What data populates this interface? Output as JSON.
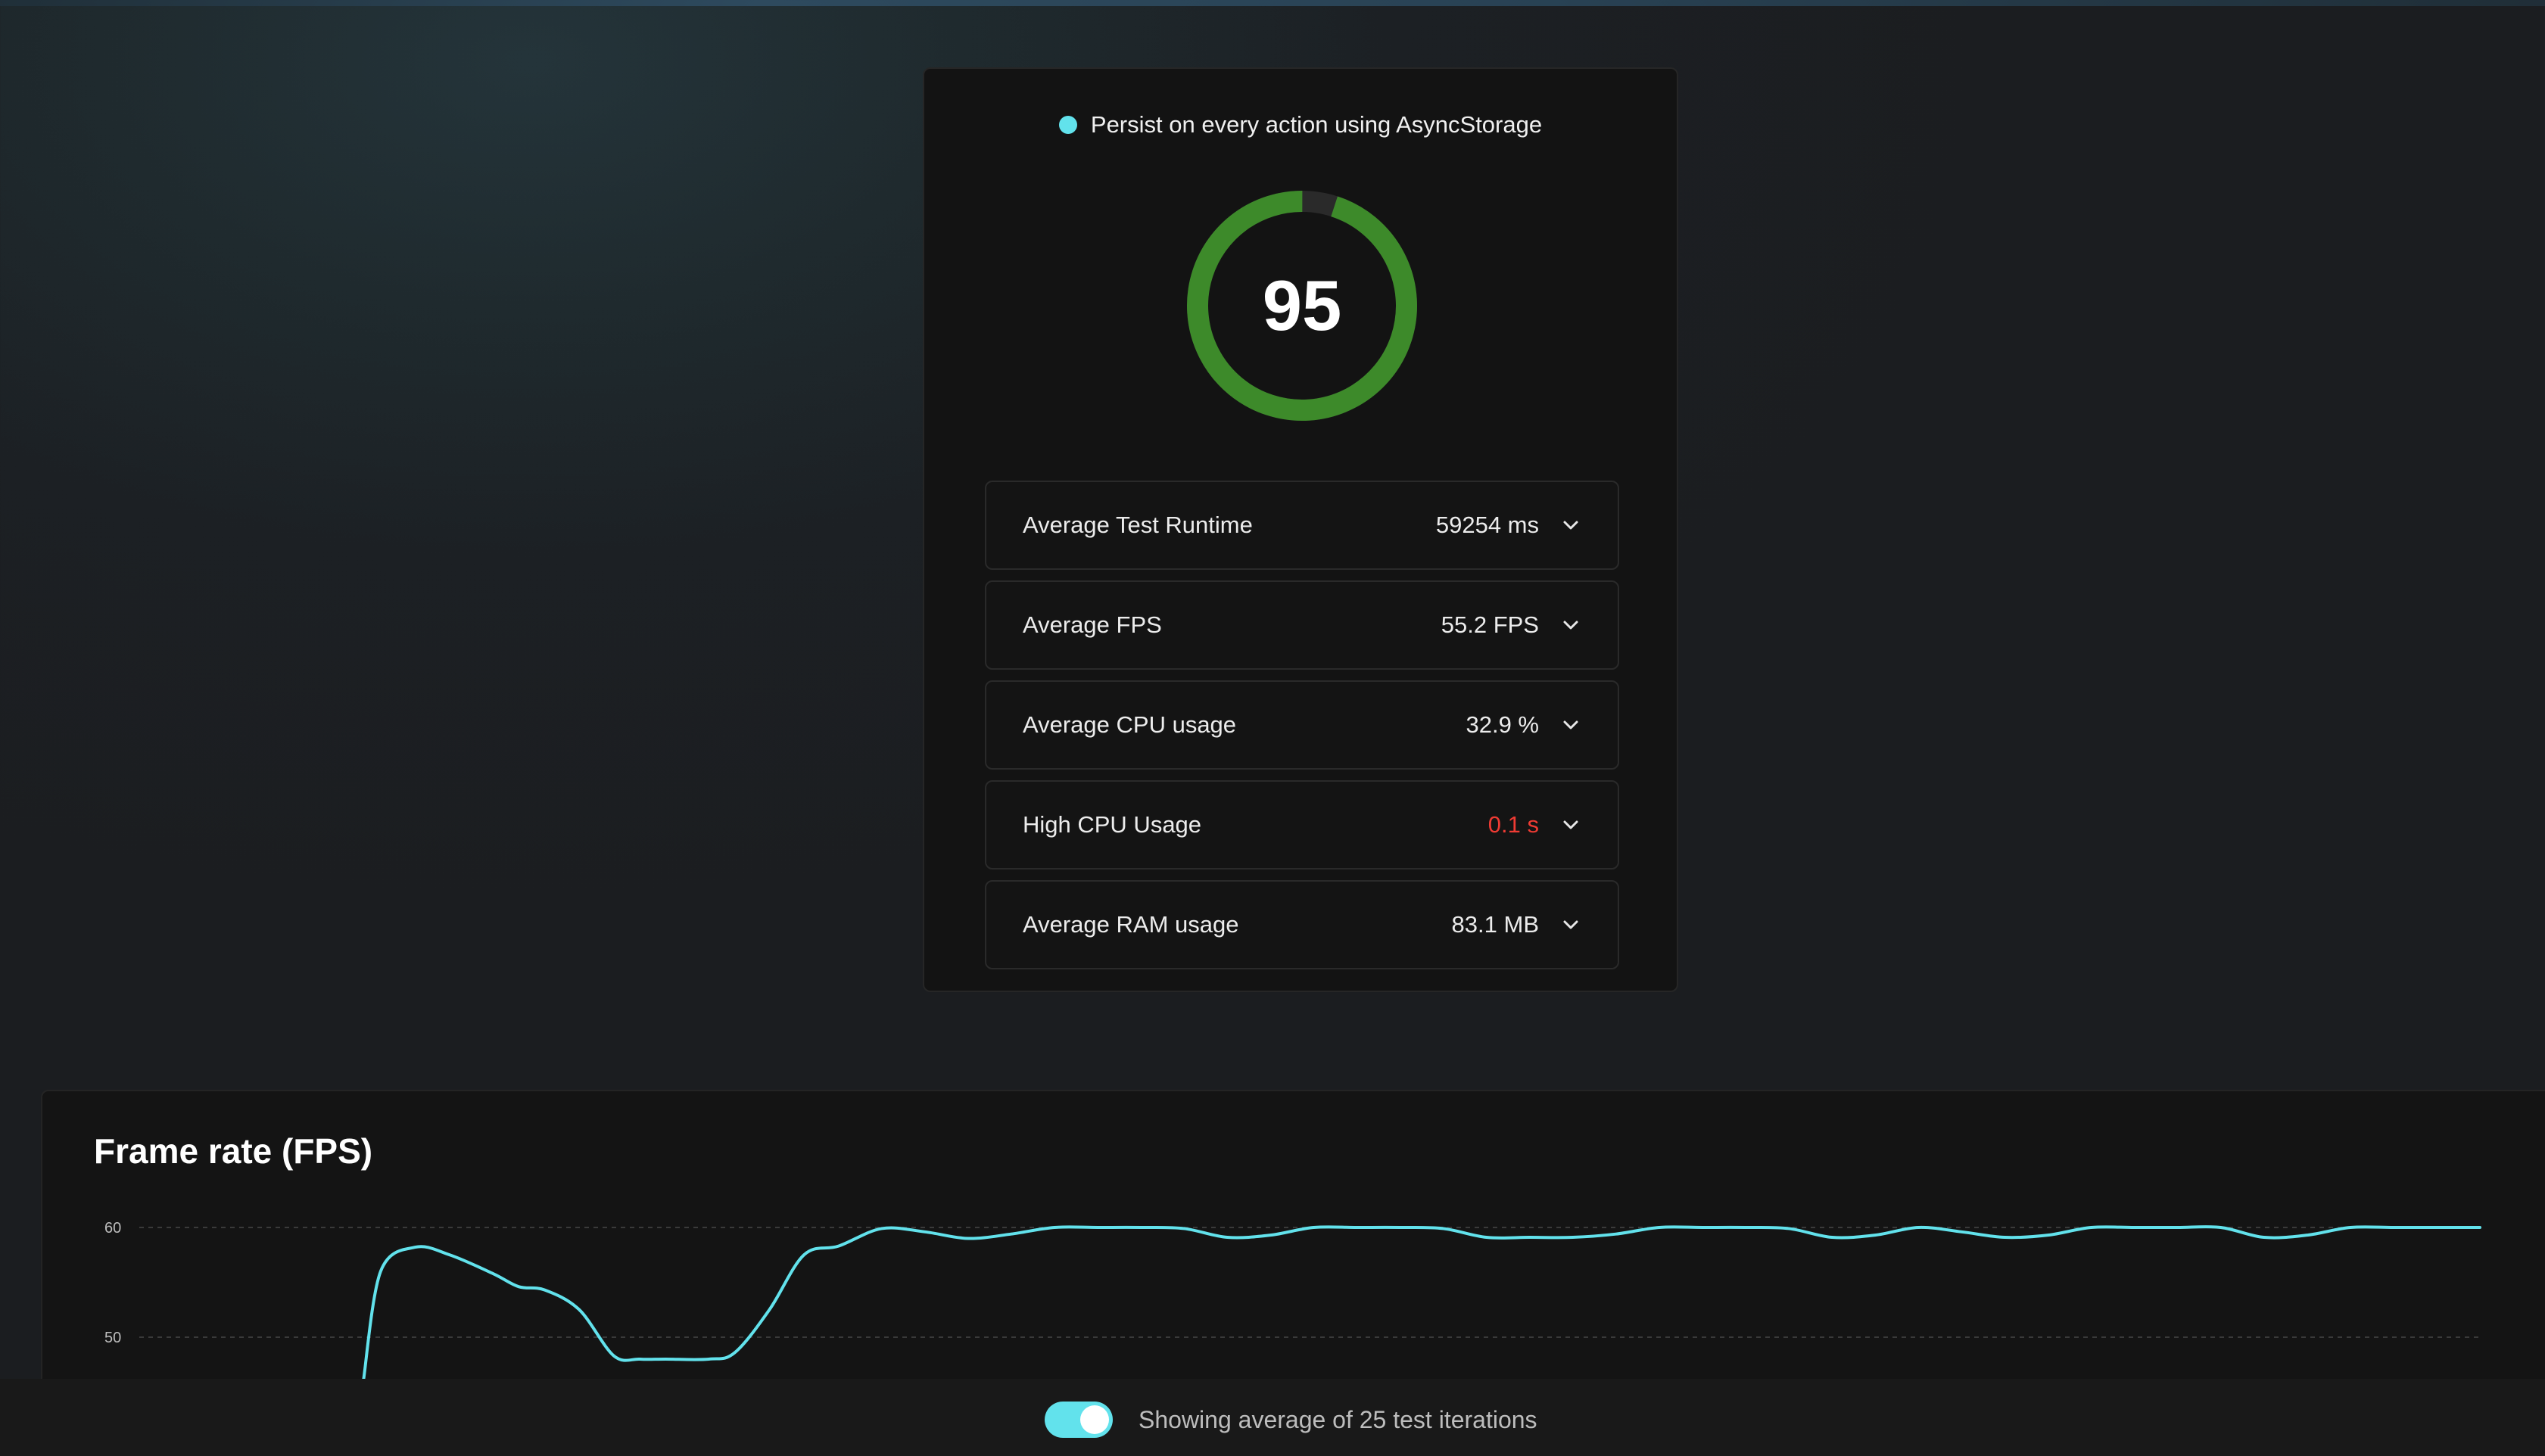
{
  "report": {
    "title": "Persist on every action using AsyncStorage",
    "title_dot_color": "#62e2ec",
    "score": "95",
    "score_fraction": 0.95,
    "score_color": "#3d8a2a",
    "metrics": [
      {
        "label": "Average Test Runtime",
        "value": "59254 ms",
        "status": "normal"
      },
      {
        "label": "Average FPS",
        "value": "55.2 FPS",
        "status": "normal"
      },
      {
        "label": "Average CPU usage",
        "value": "32.9 %",
        "status": "normal"
      },
      {
        "label": "High CPU Usage",
        "value": "0.1 s",
        "status": "danger"
      },
      {
        "label": "Average RAM usage",
        "value": "83.1 MB",
        "status": "normal"
      }
    ],
    "expand_icon": "chevron-down-icon"
  },
  "chart_data": {
    "type": "line",
    "title": "Frame rate (FPS)",
    "y_ticks": [
      "60",
      "50"
    ],
    "ylim": [
      47,
      60
    ],
    "line_color": "#62e2ec",
    "grid": "dashed horizontal",
    "series": [
      {
        "points": [
          [
            0,
            46
          ],
          [
            0.2,
            56
          ],
          [
            0.6,
            58.2
          ],
          [
            1.0,
            57.5
          ],
          [
            1.5,
            55.8
          ],
          [
            1.8,
            54.6
          ],
          [
            2.1,
            54.3
          ],
          [
            2.5,
            52.5
          ],
          [
            2.9,
            48.3
          ],
          [
            3.2,
            48.0
          ],
          [
            3.5,
            48.0
          ],
          [
            4.0,
            48.0
          ],
          [
            4.3,
            48.6
          ],
          [
            4.7,
            52.5
          ],
          [
            5.1,
            57.5
          ],
          [
            5.5,
            58.3
          ],
          [
            6.0,
            59.9
          ],
          [
            6.5,
            59.6
          ],
          [
            7.0,
            59.0
          ],
          [
            7.5,
            59.4
          ],
          [
            8.0,
            60.0
          ],
          [
            8.5,
            60.0
          ],
          [
            9.0,
            60.0
          ],
          [
            9.5,
            59.9
          ],
          [
            10.0,
            59.1
          ],
          [
            10.5,
            59.3
          ],
          [
            11.0,
            60.0
          ],
          [
            11.5,
            60.0
          ],
          [
            12.0,
            60.0
          ],
          [
            12.5,
            59.9
          ],
          [
            13.0,
            59.1
          ],
          [
            13.5,
            59.1
          ],
          [
            14.0,
            59.1
          ],
          [
            14.5,
            59.4
          ],
          [
            15.0,
            60.0
          ],
          [
            15.5,
            60.0
          ],
          [
            16.0,
            60.0
          ],
          [
            16.5,
            59.9
          ],
          [
            17.0,
            59.1
          ],
          [
            17.5,
            59.3
          ],
          [
            18.0,
            60.0
          ],
          [
            18.5,
            59.6
          ],
          [
            19.0,
            59.1
          ],
          [
            19.5,
            59.3
          ],
          [
            20.0,
            60.0
          ],
          [
            20.5,
            60.0
          ],
          [
            21.0,
            60.0
          ],
          [
            21.5,
            60.0
          ],
          [
            22.0,
            59.1
          ],
          [
            22.5,
            59.3
          ],
          [
            23.0,
            60.0
          ],
          [
            23.5,
            60.0
          ],
          [
            24.0,
            60.0
          ],
          [
            24.5,
            60.0
          ]
        ]
      }
    ]
  },
  "footer": {
    "toggle_on": true,
    "toggle_label": "Showing average of 25 test iterations"
  }
}
